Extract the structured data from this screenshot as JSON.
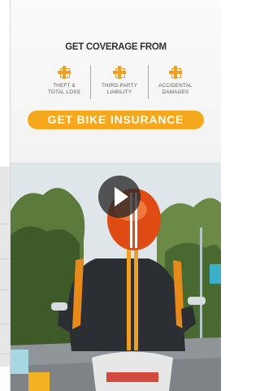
{
  "ad": {
    "headline": "GET COVERAGE FROM",
    "features": [
      {
        "icon": "plus-cross-icon",
        "line1": "THEFT &",
        "line2": "TOTAL LOSS"
      },
      {
        "icon": "plus-cross-icon",
        "line1": "THIRD-PARTY",
        "line2": "LIABILITY"
      },
      {
        "icon": "plus-cross-icon",
        "line1": "ACCIDENTAL",
        "line2": "DAMAGES"
      }
    ],
    "cta_label": "GET BIKE INSURANCE",
    "colors": {
      "accent": "#f5a81c",
      "text": "#303030"
    }
  },
  "video": {
    "play_icon": "play-icon"
  }
}
